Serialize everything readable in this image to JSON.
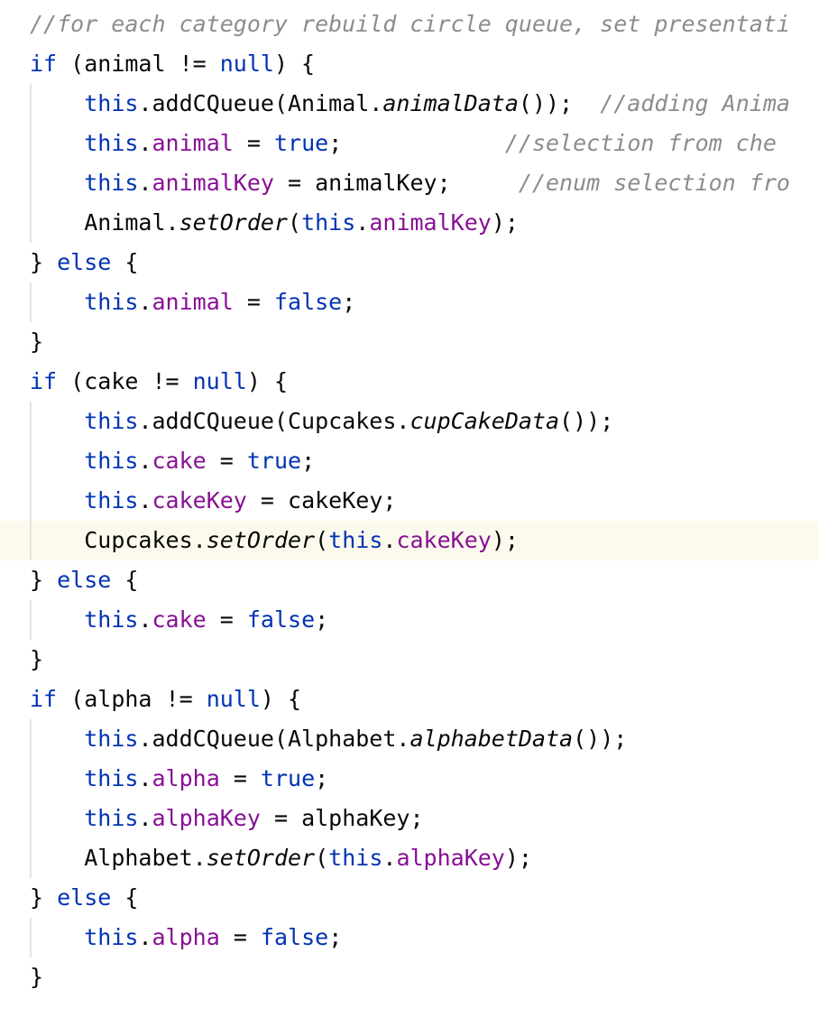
{
  "editor": {
    "current_line_index": 13,
    "lines": [
      {
        "indent": 0,
        "guide": false,
        "tokens": [
          {
            "t": "//for each category rebuild circle queue, set presentati",
            "c": "comment"
          }
        ]
      },
      {
        "indent": 0,
        "guide": false,
        "tokens": [
          {
            "t": "if",
            "c": "kw"
          },
          {
            "t": " (animal != ",
            "c": "plain"
          },
          {
            "t": "null",
            "c": "kw"
          },
          {
            "t": ") {",
            "c": "plain"
          }
        ]
      },
      {
        "indent": 4,
        "guide": true,
        "tokens": [
          {
            "t": "this",
            "c": "kw"
          },
          {
            "t": ".addCQueue(Animal.",
            "c": "plain"
          },
          {
            "t": "animalData",
            "c": "italic"
          },
          {
            "t": "());  ",
            "c": "plain"
          },
          {
            "t": "//adding Anima",
            "c": "comment"
          }
        ]
      },
      {
        "indent": 4,
        "guide": true,
        "tokens": [
          {
            "t": "this",
            "c": "kw"
          },
          {
            "t": ".",
            "c": "plain"
          },
          {
            "t": "animal",
            "c": "field"
          },
          {
            "t": " = ",
            "c": "plain"
          },
          {
            "t": "true",
            "c": "kw"
          },
          {
            "t": ";            ",
            "c": "plain"
          },
          {
            "t": "//selection from che",
            "c": "comment"
          }
        ]
      },
      {
        "indent": 4,
        "guide": true,
        "tokens": [
          {
            "t": "this",
            "c": "kw"
          },
          {
            "t": ".",
            "c": "plain"
          },
          {
            "t": "animalKey",
            "c": "field"
          },
          {
            "t": " = animalKey;     ",
            "c": "plain"
          },
          {
            "t": "//enum selection fro",
            "c": "comment"
          }
        ]
      },
      {
        "indent": 4,
        "guide": true,
        "tokens": [
          {
            "t": "Animal.",
            "c": "plain"
          },
          {
            "t": "setOrder",
            "c": "italic"
          },
          {
            "t": "(",
            "c": "plain"
          },
          {
            "t": "this",
            "c": "kw"
          },
          {
            "t": ".",
            "c": "plain"
          },
          {
            "t": "animalKey",
            "c": "field"
          },
          {
            "t": ");",
            "c": "plain"
          }
        ]
      },
      {
        "indent": 0,
        "guide": false,
        "tokens": [
          {
            "t": "} ",
            "c": "plain"
          },
          {
            "t": "else",
            "c": "kw"
          },
          {
            "t": " {",
            "c": "plain"
          }
        ]
      },
      {
        "indent": 4,
        "guide": true,
        "tokens": [
          {
            "t": "this",
            "c": "kw"
          },
          {
            "t": ".",
            "c": "plain"
          },
          {
            "t": "animal",
            "c": "field"
          },
          {
            "t": " = ",
            "c": "plain"
          },
          {
            "t": "false",
            "c": "kw"
          },
          {
            "t": ";",
            "c": "plain"
          }
        ]
      },
      {
        "indent": 0,
        "guide": false,
        "tokens": [
          {
            "t": "}",
            "c": "plain"
          }
        ]
      },
      {
        "indent": 0,
        "guide": false,
        "tokens": [
          {
            "t": "if",
            "c": "kw"
          },
          {
            "t": " (cake != ",
            "c": "plain"
          },
          {
            "t": "null",
            "c": "kw"
          },
          {
            "t": ") {",
            "c": "plain"
          }
        ]
      },
      {
        "indent": 4,
        "guide": true,
        "tokens": [
          {
            "t": "this",
            "c": "kw"
          },
          {
            "t": ".addCQueue(Cupcakes.",
            "c": "plain"
          },
          {
            "t": "cupCakeData",
            "c": "italic"
          },
          {
            "t": "());",
            "c": "plain"
          }
        ]
      },
      {
        "indent": 4,
        "guide": true,
        "tokens": [
          {
            "t": "this",
            "c": "kw"
          },
          {
            "t": ".",
            "c": "plain"
          },
          {
            "t": "cake",
            "c": "field"
          },
          {
            "t": " = ",
            "c": "plain"
          },
          {
            "t": "true",
            "c": "kw"
          },
          {
            "t": ";",
            "c": "plain"
          }
        ]
      },
      {
        "indent": 4,
        "guide": true,
        "tokens": [
          {
            "t": "this",
            "c": "kw"
          },
          {
            "t": ".",
            "c": "plain"
          },
          {
            "t": "cakeKey",
            "c": "field"
          },
          {
            "t": " = cakeKey;",
            "c": "plain"
          }
        ]
      },
      {
        "indent": 4,
        "guide": true,
        "tokens": [
          {
            "t": "Cupcakes.",
            "c": "plain"
          },
          {
            "t": "setOrder",
            "c": "italic"
          },
          {
            "t": "(",
            "c": "plain"
          },
          {
            "t": "this",
            "c": "kw"
          },
          {
            "t": ".",
            "c": "plain"
          },
          {
            "t": "cakeKey",
            "c": "field"
          },
          {
            "t": ");",
            "c": "plain"
          }
        ]
      },
      {
        "indent": 0,
        "guide": false,
        "tokens": [
          {
            "t": "} ",
            "c": "plain"
          },
          {
            "t": "else",
            "c": "kw"
          },
          {
            "t": " {",
            "c": "plain"
          }
        ]
      },
      {
        "indent": 4,
        "guide": true,
        "tokens": [
          {
            "t": "this",
            "c": "kw"
          },
          {
            "t": ".",
            "c": "plain"
          },
          {
            "t": "cake",
            "c": "field"
          },
          {
            "t": " = ",
            "c": "plain"
          },
          {
            "t": "false",
            "c": "kw"
          },
          {
            "t": ";",
            "c": "plain"
          }
        ]
      },
      {
        "indent": 0,
        "guide": false,
        "tokens": [
          {
            "t": "}",
            "c": "plain"
          }
        ]
      },
      {
        "indent": 0,
        "guide": false,
        "tokens": [
          {
            "t": "if",
            "c": "kw"
          },
          {
            "t": " (alpha != ",
            "c": "plain"
          },
          {
            "t": "null",
            "c": "kw"
          },
          {
            "t": ") {",
            "c": "plain"
          }
        ]
      },
      {
        "indent": 4,
        "guide": true,
        "tokens": [
          {
            "t": "this",
            "c": "kw"
          },
          {
            "t": ".addCQueue(Alphabet.",
            "c": "plain"
          },
          {
            "t": "alphabetData",
            "c": "italic"
          },
          {
            "t": "());",
            "c": "plain"
          }
        ]
      },
      {
        "indent": 4,
        "guide": true,
        "tokens": [
          {
            "t": "this",
            "c": "kw"
          },
          {
            "t": ".",
            "c": "plain"
          },
          {
            "t": "alpha",
            "c": "field"
          },
          {
            "t": " = ",
            "c": "plain"
          },
          {
            "t": "true",
            "c": "kw"
          },
          {
            "t": ";",
            "c": "plain"
          }
        ]
      },
      {
        "indent": 4,
        "guide": true,
        "tokens": [
          {
            "t": "this",
            "c": "kw"
          },
          {
            "t": ".",
            "c": "plain"
          },
          {
            "t": "alphaKey",
            "c": "field"
          },
          {
            "t": " = alphaKey;",
            "c": "plain"
          }
        ]
      },
      {
        "indent": 4,
        "guide": true,
        "tokens": [
          {
            "t": "Alphabet.",
            "c": "plain"
          },
          {
            "t": "setOrder",
            "c": "italic"
          },
          {
            "t": "(",
            "c": "plain"
          },
          {
            "t": "this",
            "c": "kw"
          },
          {
            "t": ".",
            "c": "plain"
          },
          {
            "t": "alphaKey",
            "c": "field"
          },
          {
            "t": ");",
            "c": "plain"
          }
        ]
      },
      {
        "indent": 0,
        "guide": false,
        "tokens": [
          {
            "t": "} ",
            "c": "plain"
          },
          {
            "t": "else",
            "c": "kw"
          },
          {
            "t": " {",
            "c": "plain"
          }
        ]
      },
      {
        "indent": 4,
        "guide": true,
        "tokens": [
          {
            "t": "this",
            "c": "kw"
          },
          {
            "t": ".",
            "c": "plain"
          },
          {
            "t": "alpha",
            "c": "field"
          },
          {
            "t": " = ",
            "c": "plain"
          },
          {
            "t": "false",
            "c": "kw"
          },
          {
            "t": ";",
            "c": "plain"
          }
        ]
      },
      {
        "indent": 0,
        "guide": false,
        "tokens": [
          {
            "t": "}",
            "c": "plain"
          }
        ]
      }
    ]
  },
  "colors": {
    "keyword": "#0033b3",
    "field": "#871094",
    "comment": "#8c8c8c",
    "text": "#080808",
    "current_line": "#fcfaed",
    "indent_guide": "#e4e4e4"
  }
}
